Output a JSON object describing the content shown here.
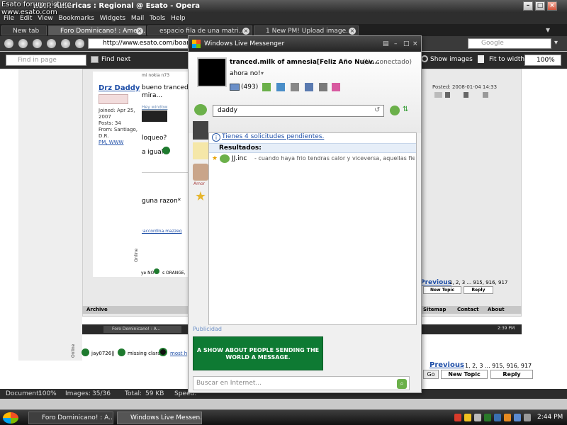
{
  "overlay_text": {
    "line1": "Esato forum picture",
    "line2": "www.esato.com"
  },
  "opera": {
    "title": "no! : Americas : Regional @ Esato - Opera",
    "menu": [
      "File",
      "Edit",
      "View",
      "Bookmarks",
      "Widgets",
      "Mail",
      "Tools",
      "Help"
    ],
    "tabs": [
      {
        "label": "New tab"
      },
      {
        "label": "Foro Dominicano! : Amer..."
      },
      {
        "label": "espacio fila de una matri..."
      },
      {
        "label": "1 New PM! Upload image..."
      }
    ],
    "address": "http://www.esato.com/board/vi",
    "search_placeholder": "Google",
    "find_placeholder": "Find in page",
    "find_next": "Find next",
    "show_images": "Show images",
    "fit_to_width": "Fit to width",
    "zoom": "100%"
  },
  "forum": {
    "username": "Drz Daddy",
    "joined": "Joined: Apr 25, 2007",
    "posts": "Posts: 34",
    "from": "From: Santiago, D.R.",
    "links": "PM, WWW",
    "post_text": "bueno tranced s",
    "post_text2": "mira...",
    "hey_window": "Hey window",
    "loqueo": "loqueo?",
    "igual": "a igual",
    "razon": "guna razon*",
    "small_link": ":accordina.mazzeg",
    "posted": "Posted: 2008-01-04 14:33",
    "previous": "Previous",
    "pages": "1, 2, 3 ... 915, 916, 917",
    "new_topic": "New Topic",
    "reply": "Reply",
    "archive": "Archive",
    "sitemap": "Sitemap",
    "contact": "Contact",
    "about": "About",
    "online": "Online",
    "footer_users": "jay0726||",
    "footer_missing": "missing clara",
    "footer_most": "most h",
    "go": "Go",
    "ye_no": "ye NO",
    "orange": "s ORANGE,",
    "nested_taskbar_item": "Foro Dominicano! : A...",
    "nested_time": "2:39 PM",
    "top_snippet": "mi nokia n73"
  },
  "status": {
    "document": "Document:",
    "doc_pct": "100%",
    "images_label": "Images:",
    "images": "35/36",
    "total_label": "Total:",
    "total": "59 KB",
    "speed_label": "Speed:"
  },
  "messenger": {
    "title": "Windows Live Messenger",
    "name": "tranced.milk of amnesia[Feliz Año Nuev...",
    "status": "(No conectado)",
    "personal_message": "ahora no!",
    "mail_count": "(493)",
    "search_value": "daddy",
    "pending": "Tienes 4 solicitudes pendientes.",
    "results_header": "Resultados:",
    "result_name": "JJ.inc",
    "result_message": "- cuando haya frio tendras calor y viceversa, aquellas fies...",
    "contact_label": "Amor",
    "ad_label": "Publicidad",
    "ad_text": "A SHOW ABOUT PEOPLE SENDING THE WORLD A MESSAGE.",
    "web_search_placeholder": "Buscar en Internet..."
  },
  "taskbar": {
    "items": [
      "Foro Dominicano! : A...",
      "Windows Live Messen..."
    ],
    "time": "2:44 PM"
  },
  "colors": {
    "chrome_dark": "#2e2e2e",
    "link_blue": "#1f4fa8",
    "ad_green": "#0e7a33",
    "results_header_bg": "#e6eef8"
  }
}
